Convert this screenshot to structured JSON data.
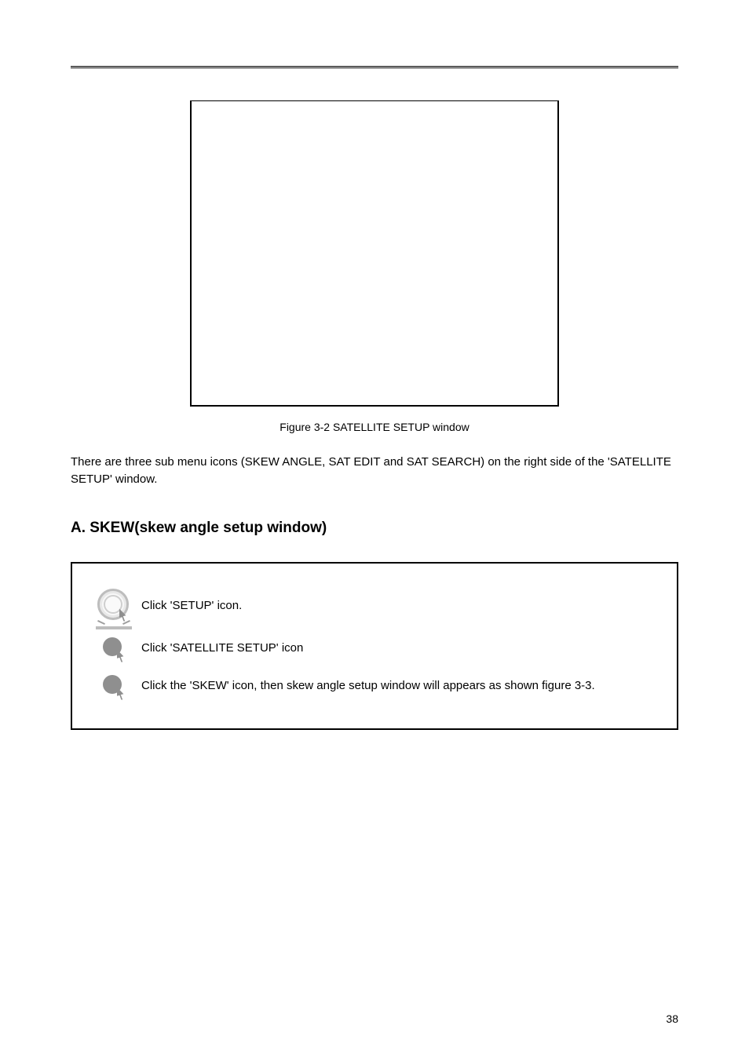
{
  "figure": {
    "caption": "Figure 3-2 SATELLITE SETUP window"
  },
  "paragraph": "There are three sub menu icons (SKEW ANGLE, SAT EDIT and SAT SEARCH) on the right side of the 'SATELLITE SETUP' window.",
  "section_title": "A. SKEW(skew angle setup window)",
  "box_items": [
    {
      "icon": "dish-big",
      "label": "Click 'SETUP' icon."
    },
    {
      "icon": "dish-small",
      "label": "Click 'SATELLITE SETUP' icon"
    },
    {
      "icon": "dish-small",
      "label": "Click the 'SKEW' icon, then skew angle setup window will appears as shown figure 3-3."
    }
  ],
  "page_number": "38"
}
